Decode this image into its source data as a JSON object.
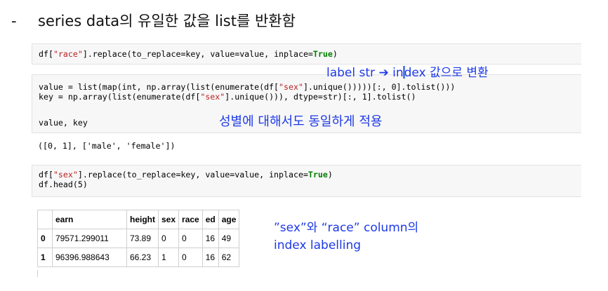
{
  "heading": {
    "bullet": "-",
    "text": "series data의 유일한 값을 list를 반환함"
  },
  "cells": {
    "cell1": {
      "line1": {
        "a": "df[",
        "s1": "\"race\"",
        "b": "].replace(to_replace=key, value=value, inplace=",
        "kw": "True",
        "c": ")"
      }
    },
    "cell2": {
      "line1": {
        "a": "value = list(map(int, np.array(list(enumerate(df[",
        "s1": "\"sex\"",
        "b": "].unique()))))[:, 0].tolist()))"
      },
      "line2": {
        "a": "key = np.array(list(enumerate(df[",
        "s1": "\"sex\"",
        "b": "].unique())), dtype=str)[:, 1].tolist()"
      },
      "line3": "value, key"
    },
    "output": "([0, 1], ['male', 'female'])",
    "cell3": {
      "line1": {
        "a": "df[",
        "s1": "\"sex\"",
        "b": "].replace(to_replace=key, value=value, inplace=",
        "kw": "True",
        "c": ")"
      },
      "line2": "df.head(5)"
    }
  },
  "annotations": {
    "label_conversion": {
      "before": "label str ",
      "arrow": "➔",
      "after_i": " in",
      "after_rest": "dex 값으로 변환"
    },
    "gender_note": "성별에 대해서도 동일하게 적용",
    "column_note_line1": "”sex”와 “race” column의",
    "column_note_line2": "index labelling"
  },
  "table": {
    "columns": [
      "",
      "earn",
      "height",
      "sex",
      "race",
      "ed",
      "age"
    ],
    "rows": [
      [
        "0",
        "79571.299011",
        "73.89",
        "0",
        "0",
        "16",
        "49"
      ],
      [
        "1",
        "96396.988643",
        "66.23",
        "1",
        "0",
        "16",
        "62"
      ]
    ]
  },
  "colors": {
    "annotation": "#1d39e8",
    "string": "#ba2121",
    "keyword": "#008000",
    "cell_bg": "#f7f7f7"
  }
}
